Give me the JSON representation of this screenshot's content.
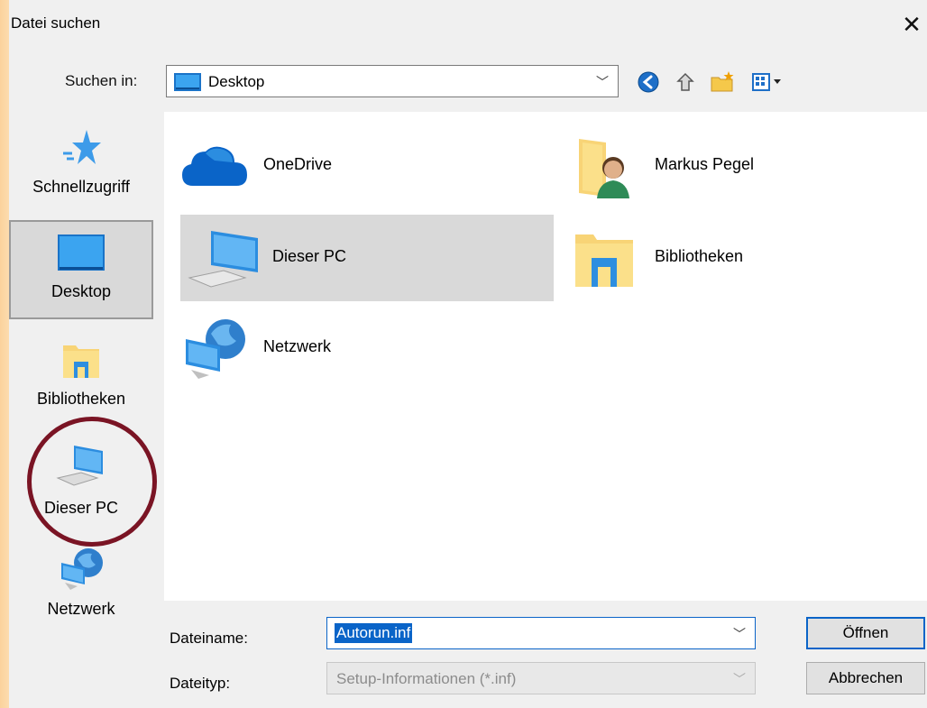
{
  "window": {
    "title": "Datei suchen",
    "close_glyph": "✕"
  },
  "lookin": {
    "label": "Suchen in:",
    "value": "Desktop",
    "icon": "desktop-icon"
  },
  "toolbar": {
    "buttons": [
      {
        "name": "back-icon"
      },
      {
        "name": "up-folder-icon"
      },
      {
        "name": "new-folder-icon"
      },
      {
        "name": "view-menu-icon"
      }
    ]
  },
  "places": [
    {
      "label": "Schnellzugriff",
      "icon": "star-icon",
      "selected": false
    },
    {
      "label": "Desktop",
      "icon": "desktop-icon",
      "selected": true
    },
    {
      "label": "Bibliotheken",
      "icon": "library-icon",
      "selected": false
    },
    {
      "label": "Dieser PC",
      "icon": "computer-icon",
      "selected": false
    },
    {
      "label": "Netzwerk",
      "icon": "network-icon",
      "selected": false
    }
  ],
  "files": [
    {
      "label": "OneDrive",
      "icon": "onedrive-icon"
    },
    {
      "label": "Markus Pegel",
      "icon": "user-folder-icon"
    },
    {
      "label": "Dieser PC",
      "icon": "computer-icon",
      "selected": true
    },
    {
      "label": "Bibliotheken",
      "icon": "library-icon"
    },
    {
      "label": "Netzwerk",
      "icon": "network-icon"
    }
  ],
  "filename": {
    "label": "Dateiname:",
    "value": "Autorun.inf"
  },
  "filetype": {
    "label": "Dateityp:",
    "value": "Setup-Informationen (*.inf)"
  },
  "buttons": {
    "open": "Öffnen",
    "cancel": "Abbrechen"
  },
  "colors": {
    "accent": "#0a64c8",
    "highlight_circle": "#7a1424",
    "selection": "#d9d9d9"
  }
}
